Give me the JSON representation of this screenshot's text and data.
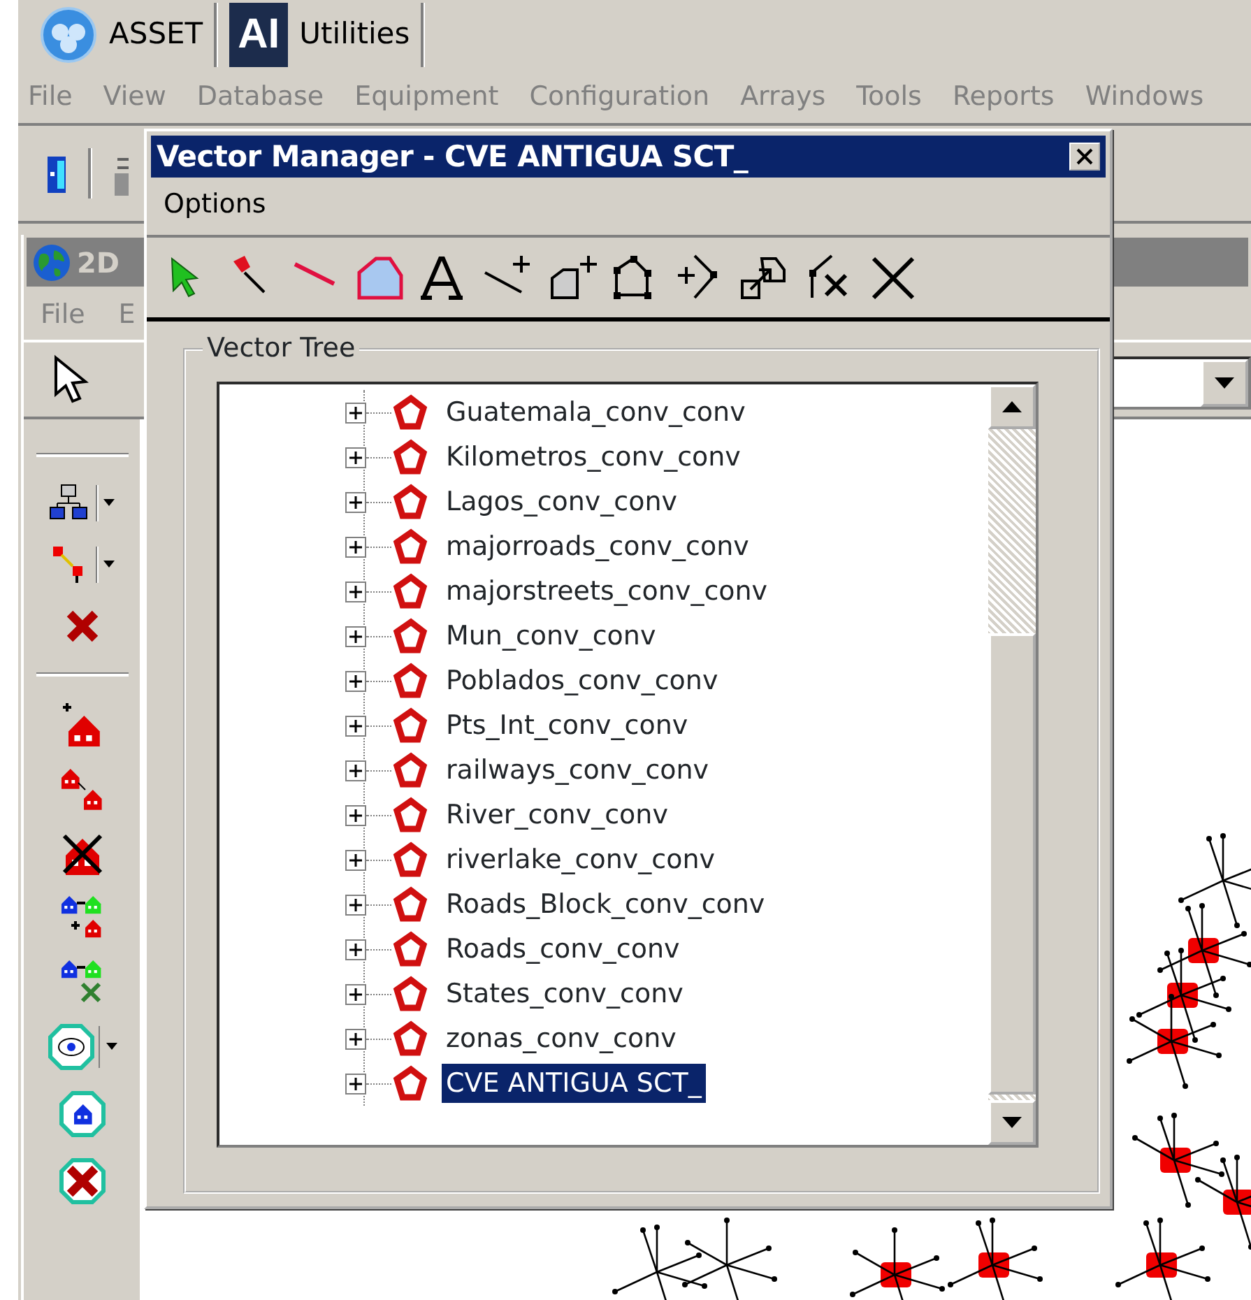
{
  "app_tabs": [
    {
      "kind": "globe",
      "label": "ASSET"
    },
    {
      "kind": "logo",
      "logo_text": "AI",
      "label": "Utilities"
    }
  ],
  "menu": [
    {
      "label": "File",
      "disabled": true
    },
    {
      "label": "View",
      "disabled": true
    },
    {
      "label": "Database",
      "disabled": true
    },
    {
      "label": "Equipment",
      "disabled": true
    },
    {
      "label": "Configuration",
      "disabled": true
    },
    {
      "label": "Arrays",
      "disabled": true
    },
    {
      "label": "Tools",
      "disabled": true
    },
    {
      "label": "Reports",
      "disabled": true
    },
    {
      "label": "Windows",
      "disabled": true
    }
  ],
  "inner_window": {
    "title": "2D",
    "menu": [
      "File",
      "E"
    ]
  },
  "dialog": {
    "title": "Vector Manager - CVE ANTIGUA SCT_",
    "menu": [
      "Options"
    ],
    "group_label": "Vector Tree",
    "tree": [
      {
        "label": "Guatemala_conv_conv",
        "expanded": false,
        "selected": false
      },
      {
        "label": "Kilometros_conv_conv",
        "expanded": false,
        "selected": false
      },
      {
        "label": "Lagos_conv_conv",
        "expanded": false,
        "selected": false
      },
      {
        "label": "majorroads_conv_conv",
        "expanded": false,
        "selected": false
      },
      {
        "label": "majorstreets_conv_conv",
        "expanded": false,
        "selected": false
      },
      {
        "label": "Mun_conv_conv",
        "expanded": false,
        "selected": false
      },
      {
        "label": "Poblados_conv_conv",
        "expanded": false,
        "selected": false
      },
      {
        "label": "Pts_Int_conv_conv",
        "expanded": false,
        "selected": false
      },
      {
        "label": "railways_conv_conv",
        "expanded": false,
        "selected": false
      },
      {
        "label": "River_conv_conv",
        "expanded": false,
        "selected": false
      },
      {
        "label": "riverlake_conv_conv",
        "expanded": false,
        "selected": false
      },
      {
        "label": "Roads_Block_conv_conv",
        "expanded": false,
        "selected": false
      },
      {
        "label": "Roads_conv_conv",
        "expanded": false,
        "selected": false
      },
      {
        "label": "States_conv_conv",
        "expanded": false,
        "selected": false
      },
      {
        "label": "zonas_conv_conv",
        "expanded": false,
        "selected": false
      },
      {
        "label": "CVE ANTIGUA SCT_",
        "expanded": false,
        "selected": true
      }
    ]
  }
}
